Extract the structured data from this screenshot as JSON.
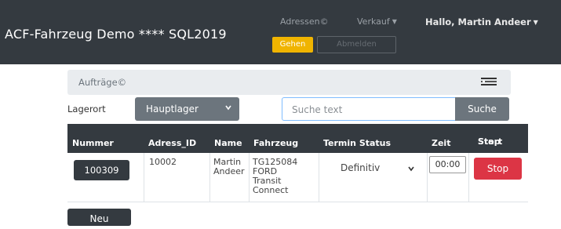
{
  "navbar": {
    "brand": "ACF-Fahrzeug Demo **** SQL2019",
    "addresses_link": "Adressen©",
    "sales_menu": "Verkauf",
    "user_greeting": "Hallo, Martin Andeer",
    "go_button": "Gehen",
    "logout_button": "Abmelden"
  },
  "breadcrumb": {
    "label": "Aufträge©"
  },
  "filter": {
    "storage_label": "Lagerort",
    "storage_value": "Hauptlager",
    "search_placeholder": "Suche text",
    "search_button": "Suche"
  },
  "table": {
    "headers": {
      "number": "Nummer",
      "address_id": "Adress_ID",
      "name": "Name",
      "vehicle": "Fahrzeug",
      "status": "Termin Status",
      "time": "Zeit",
      "start_stop_1": "Start",
      "start_stop_2": "Stop"
    },
    "rows": [
      {
        "number": "100309",
        "address_id": "10002",
        "name_1": "Martin",
        "name_2": "Andeer",
        "vehicle_1": "TG125084",
        "vehicle_2": "FORD",
        "vehicle_3": "Transit",
        "vehicle_4": "Connect",
        "status": "Definitiv",
        "time": "00:00",
        "action": "Stop"
      }
    ]
  },
  "actions": {
    "new_button": "Neu"
  },
  "colors": {
    "navbar": "#343a40",
    "warning": "#f0b400",
    "secondary": "#6c757d",
    "danger": "#dc3545",
    "focus_border": "#80bdff"
  }
}
